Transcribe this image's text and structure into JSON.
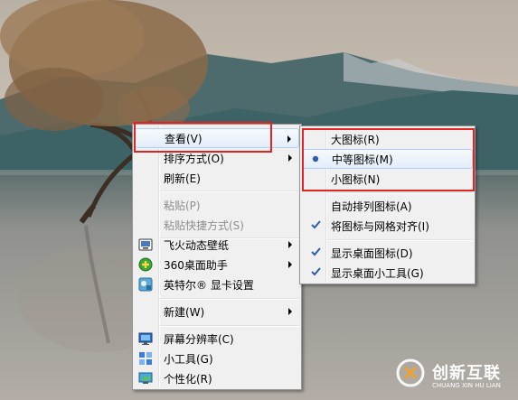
{
  "main_menu": {
    "view": "查看(V)",
    "sort": "排序方式(O)",
    "refresh": "刷新(E)",
    "paste": "粘贴(P)",
    "paste_shortcut": "粘贴快捷方式(S)",
    "flash_wallpaper": "飞火动态壁纸",
    "desktop_360": "360桌面助手",
    "intel_graphics": "英特尔® 显卡设置",
    "new": "新建(W)",
    "resolution": "屏幕分辨率(C)",
    "gadgets": "小工具(G)",
    "personalize": "个性化(R)"
  },
  "view_submenu": {
    "large_icons": "大图标(R)",
    "medium_icons": "中等图标(M)",
    "small_icons": "小图标(N)",
    "auto_arrange": "自动排列图标(A)",
    "align_grid": "将图标与网格对齐(I)",
    "show_icons": "显示桌面图标(D)",
    "show_gadgets": "显示桌面小工具(G)"
  },
  "watermark": {
    "cn": "创新互联",
    "en": "CHUANG XIN HU LIAN"
  },
  "colors": {
    "highlight_box": "#e32222",
    "check": "#2a5fb0"
  }
}
